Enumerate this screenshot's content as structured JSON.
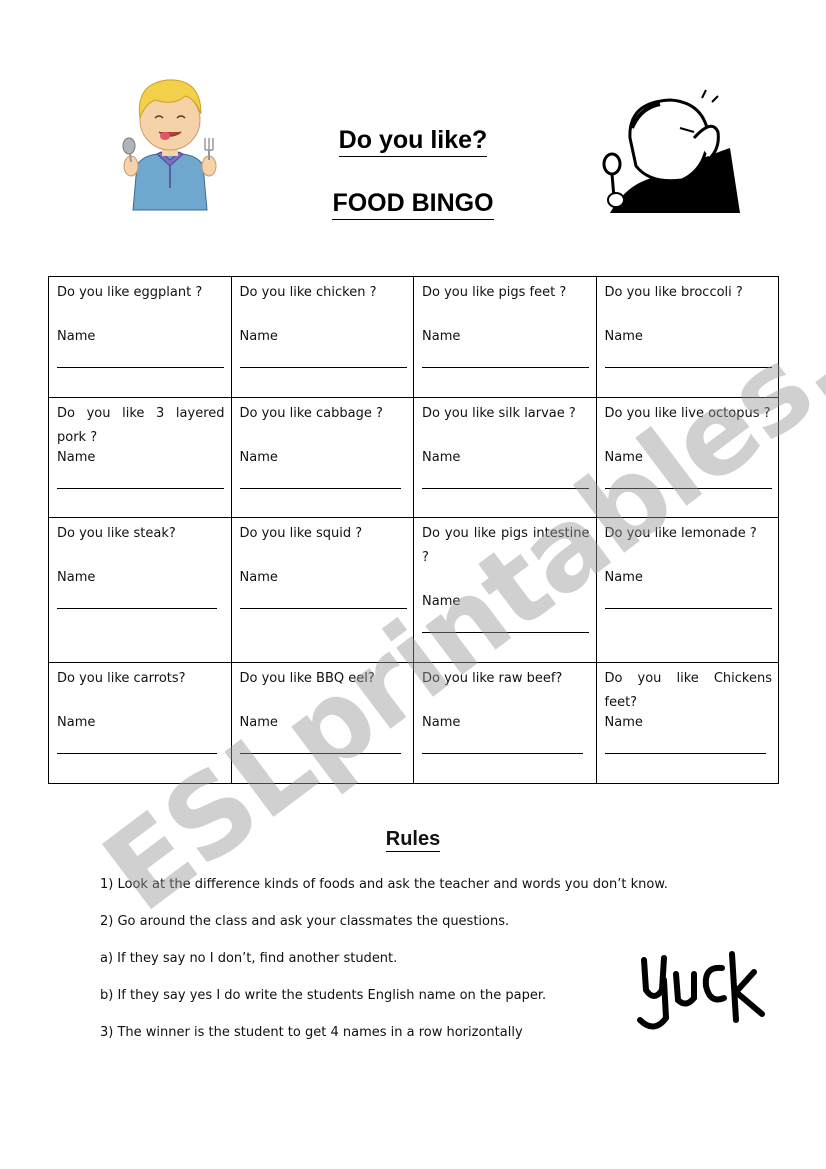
{
  "header": {
    "title": "Do you like?",
    "subtitle": "FOOD BINGO"
  },
  "illustrations": {
    "boy": "happy-boy-with-spoon-and-fork",
    "man": "disgusted-man-holding-nose-with-spoon",
    "yuck": "Yuck"
  },
  "grid": {
    "name_label": "Name",
    "rows": [
      [
        {
          "question": "Do you like eggplant ?"
        },
        {
          "question": "Do you like chicken ?"
        },
        {
          "question": "Do you like pigs feet ?"
        },
        {
          "question": "Do you like broccoli ?"
        }
      ],
      [
        {
          "question": "Do you like 3 layered pork ?"
        },
        {
          "question": "Do you like cabbage ?"
        },
        {
          "question": "Do you like silk larvae ?"
        },
        {
          "question": "Do you like live octopus ?"
        }
      ],
      [
        {
          "question": "Do you like steak?"
        },
        {
          "question": "Do you like squid ?"
        },
        {
          "question": "Do you like pigs intestine ?"
        },
        {
          "question": "Do you like lemonade ?"
        }
      ],
      [
        {
          "question": "Do you like carrots?"
        },
        {
          "question": "Do you like BBQ eel?"
        },
        {
          "question": "Do you like raw beef?"
        },
        {
          "question": "Do you like Chickens feet?"
        }
      ]
    ]
  },
  "rules": {
    "title": "Rules",
    "items": [
      "1) Look at the difference kinds of foods and ask the teacher and words you don’t know.",
      "2) Go around the class and ask your classmates the questions.",
      "a) If they say no I don’t, find another student.",
      "b) If they say yes I do write the students English name on the paper.",
      "3) The winner is the student to get 4 names in a row horizontally"
    ]
  },
  "watermark": "ESLprintables.com"
}
